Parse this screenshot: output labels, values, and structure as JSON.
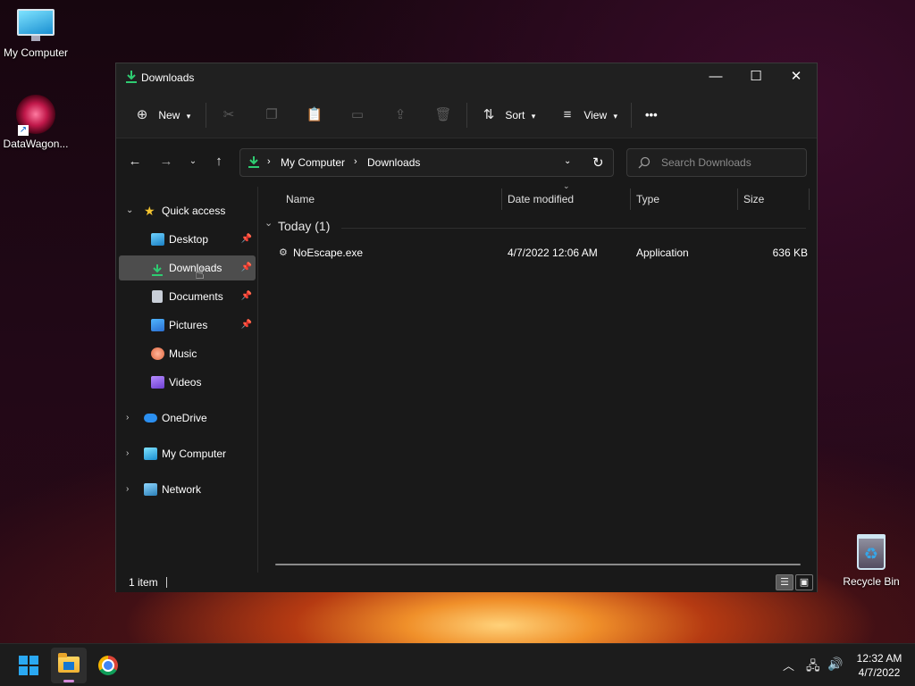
{
  "desktop": {
    "icons": [
      {
        "label": "My Computer"
      },
      {
        "label": "DataWagon..."
      },
      {
        "label": "Recycle Bin"
      }
    ]
  },
  "window": {
    "title": "Downloads",
    "toolbar": {
      "new_label": "New",
      "sort_label": "Sort",
      "view_label": "View",
      "more_label": "•••"
    },
    "address": {
      "segments": [
        "My Computer",
        "Downloads"
      ]
    },
    "search": {
      "placeholder": "Search Downloads"
    },
    "sidebar": {
      "quick_access": "Quick access",
      "items": [
        {
          "label": "Desktop",
          "pinned": true
        },
        {
          "label": "Downloads",
          "pinned": true,
          "selected": true
        },
        {
          "label": "Documents",
          "pinned": true
        },
        {
          "label": "Pictures",
          "pinned": true
        },
        {
          "label": "Music",
          "pinned": false
        },
        {
          "label": "Videos",
          "pinned": false
        }
      ],
      "roots": [
        {
          "label": "OneDrive"
        },
        {
          "label": "My Computer"
        },
        {
          "label": "Network"
        }
      ]
    },
    "columns": {
      "name": "Name",
      "date": "Date modified",
      "type": "Type",
      "size": "Size"
    },
    "group": {
      "label": "Today (1)"
    },
    "files": [
      {
        "name": "NoEscape.exe",
        "date": "4/7/2022 12:06 AM",
        "type": "Application",
        "size": "636 KB"
      }
    ],
    "status": {
      "count": "1 item"
    }
  },
  "taskbar": {
    "time": "12:32 AM",
    "date": "4/7/2022"
  },
  "colors": {
    "accent_download": "#2ecc71",
    "window_bg": "#191919",
    "selected_bg": "#4d4d4d"
  }
}
